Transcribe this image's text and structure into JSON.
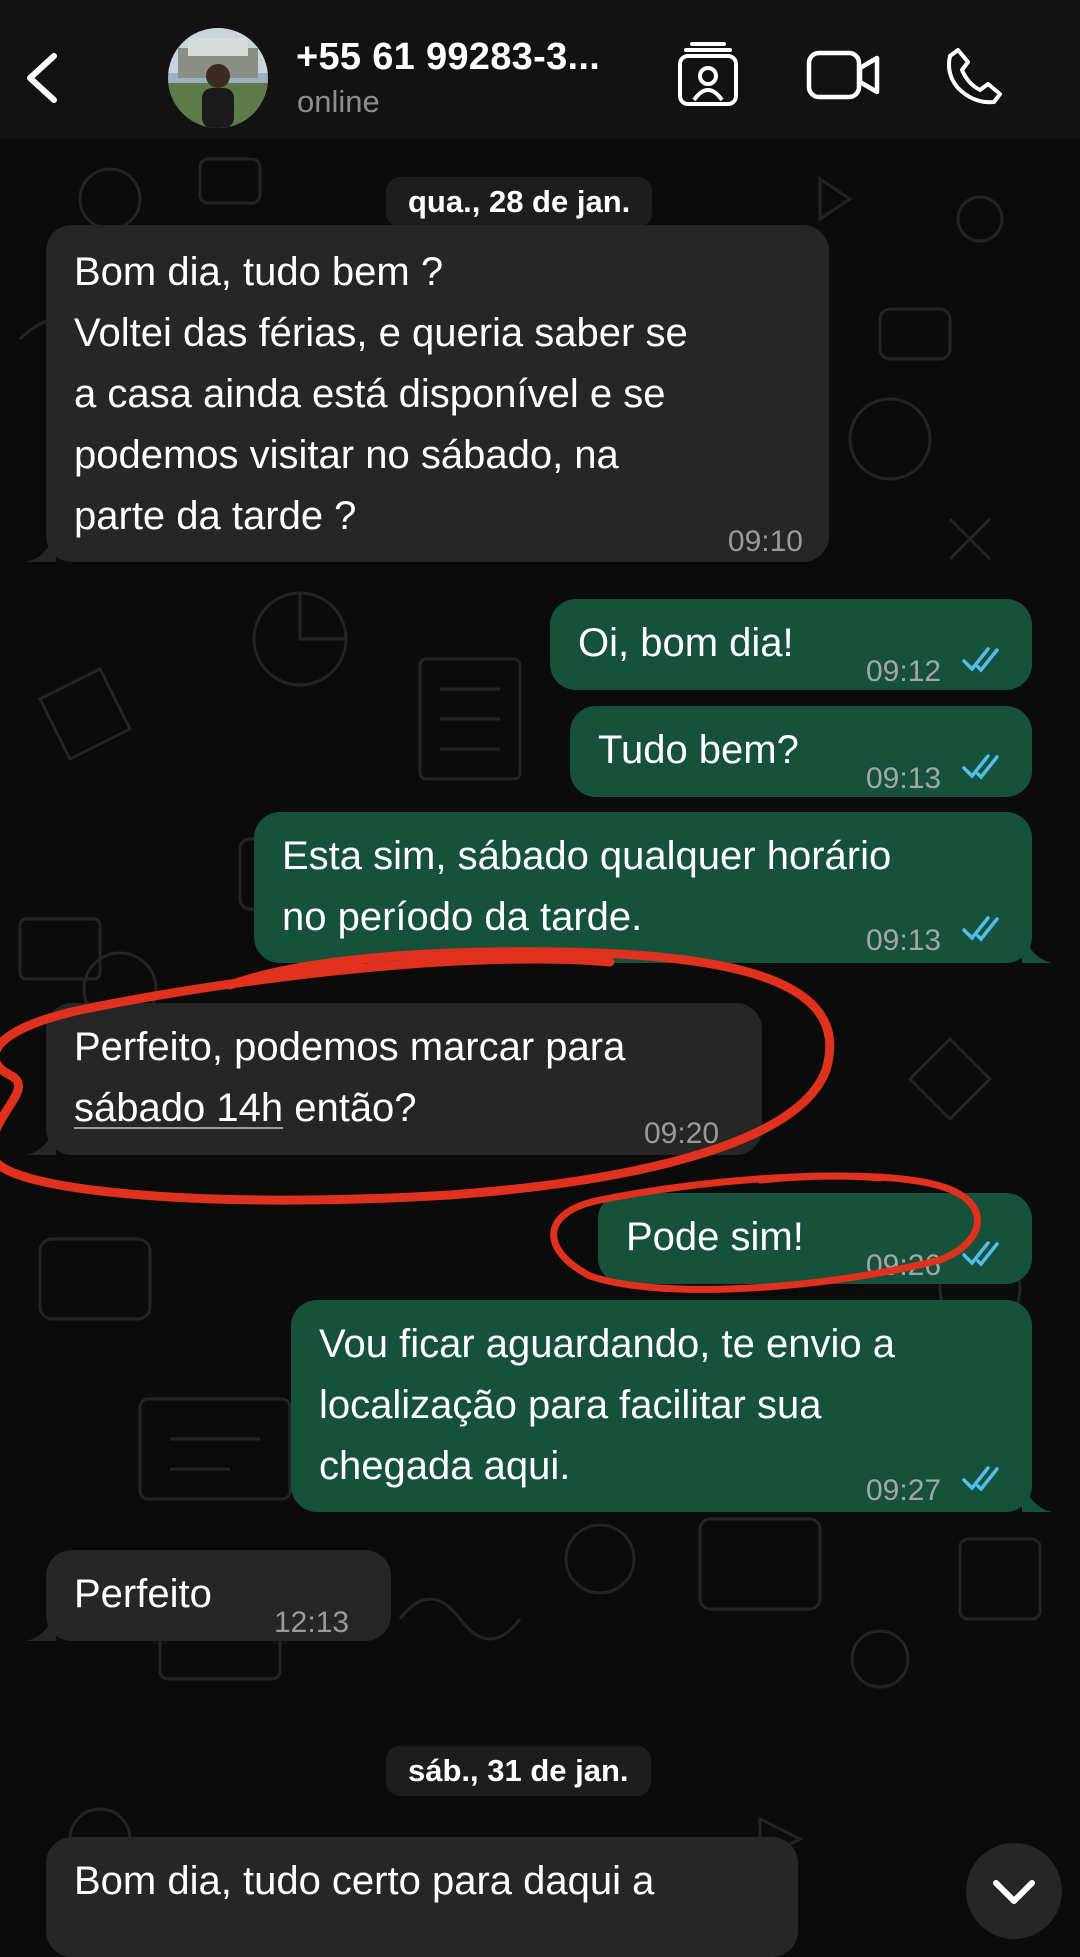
{
  "header": {
    "contact_name": "+55 61 99283-3...",
    "status": "online",
    "icons": [
      "back-chevron-icon",
      "contact-card-icon",
      "video-call-icon",
      "phone-call-icon"
    ]
  },
  "dates": {
    "first": "qua., 28 de jan.",
    "second": "sáb., 31 de jan."
  },
  "messages": [
    {
      "direction": "incoming",
      "lines": [
        "Bom dia, tudo bem ?",
        "Voltei das férias, e queria saber se",
        "a casa ainda está disponível e se",
        "podemos visitar no sábado, na",
        "parte da tarde ?"
      ],
      "time": "09:10"
    },
    {
      "direction": "outgoing",
      "lines": [
        "Oi, bom dia!"
      ],
      "time": "09:12",
      "read": true
    },
    {
      "direction": "outgoing",
      "lines": [
        "Tudo bem?"
      ],
      "time": "09:13",
      "read": true
    },
    {
      "direction": "outgoing",
      "lines": [
        "Esta sim, sábado qualquer horário",
        "no período da tarde."
      ],
      "time": "09:13",
      "read": true
    },
    {
      "direction": "incoming",
      "line1": "Perfeito, podemos marcar para",
      "line2_link": "sábado 14h",
      "line2_rest": " então?",
      "time": "09:20",
      "highlighted": true
    },
    {
      "direction": "outgoing",
      "lines": [
        "Pode sim!"
      ],
      "time": "09:26",
      "read": true,
      "highlighted": true
    },
    {
      "direction": "outgoing",
      "lines": [
        "Vou ficar aguardando, te envio a",
        "localização para facilitar sua",
        "chegada aqui."
      ],
      "time": "09:27",
      "read": true
    },
    {
      "direction": "incoming",
      "lines": [
        "Perfeito"
      ],
      "time": "12:13"
    },
    {
      "direction": "incoming",
      "lines": [
        "Bom dia, tudo certo para daqui a"
      ],
      "time": ""
    }
  ],
  "colors": {
    "background": "#0b0b0b",
    "header": "#121212",
    "incoming_bubble": "#262626",
    "outgoing_bubble": "#16513c",
    "read_ticks": "#53bdeb",
    "annotation": "#e0301e"
  }
}
